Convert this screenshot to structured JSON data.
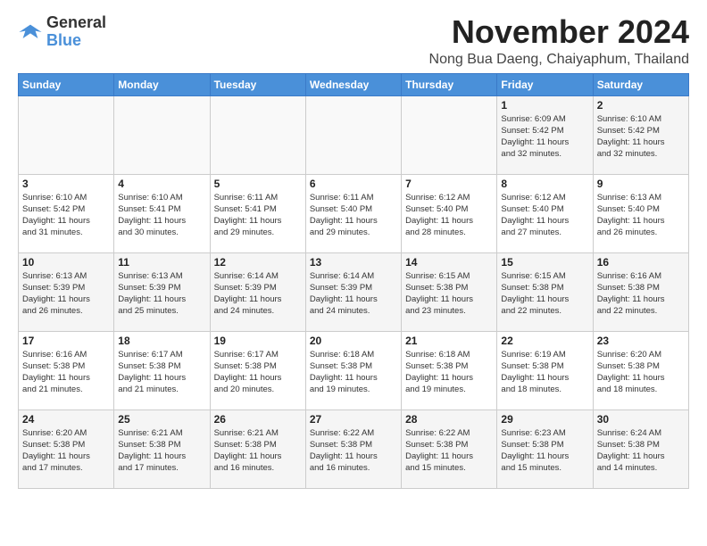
{
  "logo": {
    "line1": "General",
    "line2": "Blue"
  },
  "title": "November 2024",
  "location": "Nong Bua Daeng, Chaiyaphum, Thailand",
  "days_of_week": [
    "Sunday",
    "Monday",
    "Tuesday",
    "Wednesday",
    "Thursday",
    "Friday",
    "Saturday"
  ],
  "weeks": [
    [
      {
        "num": "",
        "info": ""
      },
      {
        "num": "",
        "info": ""
      },
      {
        "num": "",
        "info": ""
      },
      {
        "num": "",
        "info": ""
      },
      {
        "num": "",
        "info": ""
      },
      {
        "num": "1",
        "info": "Sunrise: 6:09 AM\nSunset: 5:42 PM\nDaylight: 11 hours\nand 32 minutes."
      },
      {
        "num": "2",
        "info": "Sunrise: 6:10 AM\nSunset: 5:42 PM\nDaylight: 11 hours\nand 32 minutes."
      }
    ],
    [
      {
        "num": "3",
        "info": "Sunrise: 6:10 AM\nSunset: 5:42 PM\nDaylight: 11 hours\nand 31 minutes."
      },
      {
        "num": "4",
        "info": "Sunrise: 6:10 AM\nSunset: 5:41 PM\nDaylight: 11 hours\nand 30 minutes."
      },
      {
        "num": "5",
        "info": "Sunrise: 6:11 AM\nSunset: 5:41 PM\nDaylight: 11 hours\nand 29 minutes."
      },
      {
        "num": "6",
        "info": "Sunrise: 6:11 AM\nSunset: 5:40 PM\nDaylight: 11 hours\nand 29 minutes."
      },
      {
        "num": "7",
        "info": "Sunrise: 6:12 AM\nSunset: 5:40 PM\nDaylight: 11 hours\nand 28 minutes."
      },
      {
        "num": "8",
        "info": "Sunrise: 6:12 AM\nSunset: 5:40 PM\nDaylight: 11 hours\nand 27 minutes."
      },
      {
        "num": "9",
        "info": "Sunrise: 6:13 AM\nSunset: 5:40 PM\nDaylight: 11 hours\nand 26 minutes."
      }
    ],
    [
      {
        "num": "10",
        "info": "Sunrise: 6:13 AM\nSunset: 5:39 PM\nDaylight: 11 hours\nand 26 minutes."
      },
      {
        "num": "11",
        "info": "Sunrise: 6:13 AM\nSunset: 5:39 PM\nDaylight: 11 hours\nand 25 minutes."
      },
      {
        "num": "12",
        "info": "Sunrise: 6:14 AM\nSunset: 5:39 PM\nDaylight: 11 hours\nand 24 minutes."
      },
      {
        "num": "13",
        "info": "Sunrise: 6:14 AM\nSunset: 5:39 PM\nDaylight: 11 hours\nand 24 minutes."
      },
      {
        "num": "14",
        "info": "Sunrise: 6:15 AM\nSunset: 5:38 PM\nDaylight: 11 hours\nand 23 minutes."
      },
      {
        "num": "15",
        "info": "Sunrise: 6:15 AM\nSunset: 5:38 PM\nDaylight: 11 hours\nand 22 minutes."
      },
      {
        "num": "16",
        "info": "Sunrise: 6:16 AM\nSunset: 5:38 PM\nDaylight: 11 hours\nand 22 minutes."
      }
    ],
    [
      {
        "num": "17",
        "info": "Sunrise: 6:16 AM\nSunset: 5:38 PM\nDaylight: 11 hours\nand 21 minutes."
      },
      {
        "num": "18",
        "info": "Sunrise: 6:17 AM\nSunset: 5:38 PM\nDaylight: 11 hours\nand 21 minutes."
      },
      {
        "num": "19",
        "info": "Sunrise: 6:17 AM\nSunset: 5:38 PM\nDaylight: 11 hours\nand 20 minutes."
      },
      {
        "num": "20",
        "info": "Sunrise: 6:18 AM\nSunset: 5:38 PM\nDaylight: 11 hours\nand 19 minutes."
      },
      {
        "num": "21",
        "info": "Sunrise: 6:18 AM\nSunset: 5:38 PM\nDaylight: 11 hours\nand 19 minutes."
      },
      {
        "num": "22",
        "info": "Sunrise: 6:19 AM\nSunset: 5:38 PM\nDaylight: 11 hours\nand 18 minutes."
      },
      {
        "num": "23",
        "info": "Sunrise: 6:20 AM\nSunset: 5:38 PM\nDaylight: 11 hours\nand 18 minutes."
      }
    ],
    [
      {
        "num": "24",
        "info": "Sunrise: 6:20 AM\nSunset: 5:38 PM\nDaylight: 11 hours\nand 17 minutes."
      },
      {
        "num": "25",
        "info": "Sunrise: 6:21 AM\nSunset: 5:38 PM\nDaylight: 11 hours\nand 17 minutes."
      },
      {
        "num": "26",
        "info": "Sunrise: 6:21 AM\nSunset: 5:38 PM\nDaylight: 11 hours\nand 16 minutes."
      },
      {
        "num": "27",
        "info": "Sunrise: 6:22 AM\nSunset: 5:38 PM\nDaylight: 11 hours\nand 16 minutes."
      },
      {
        "num": "28",
        "info": "Sunrise: 6:22 AM\nSunset: 5:38 PM\nDaylight: 11 hours\nand 15 minutes."
      },
      {
        "num": "29",
        "info": "Sunrise: 6:23 AM\nSunset: 5:38 PM\nDaylight: 11 hours\nand 15 minutes."
      },
      {
        "num": "30",
        "info": "Sunrise: 6:24 AM\nSunset: 5:38 PM\nDaylight: 11 hours\nand 14 minutes."
      }
    ]
  ]
}
